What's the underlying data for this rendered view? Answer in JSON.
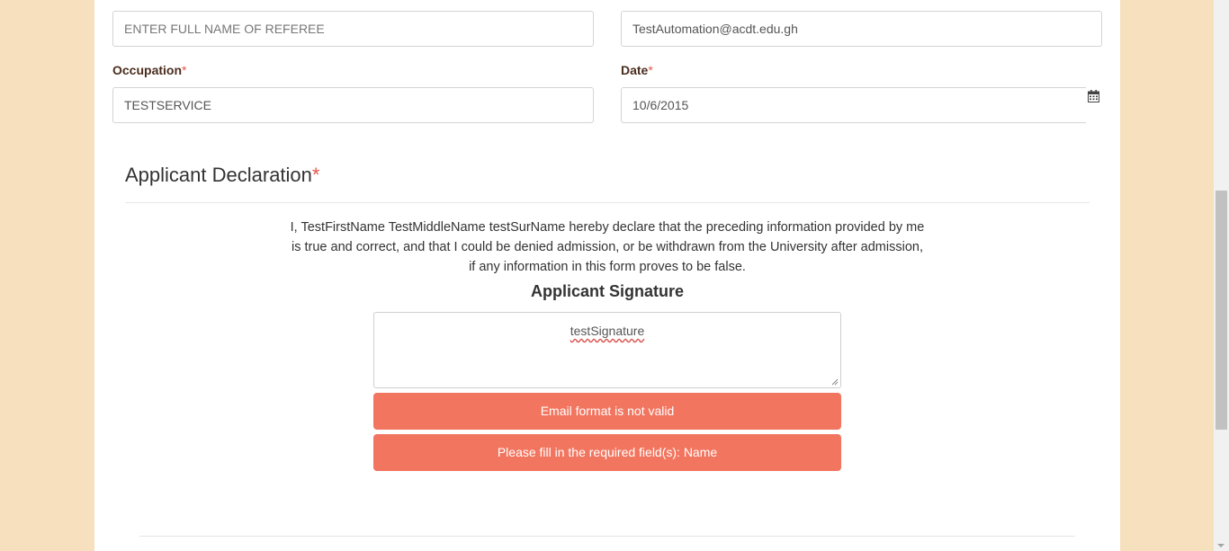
{
  "form": {
    "referee_name": {
      "placeholder": "ENTER FULL NAME OF REFEREE",
      "value": ""
    },
    "referee_email": {
      "value": "TestAutomation@acdt.edu.gh"
    },
    "occupation": {
      "label": "Occupation",
      "required_mark": "*",
      "value": "TESTSERVICE"
    },
    "date": {
      "label": "Date",
      "required_mark": "*",
      "value": "10/6/2015",
      "icon": "calendar-icon"
    }
  },
  "declaration": {
    "title": "Applicant Declaration",
    "required_mark": "*",
    "text": "I, TestFirstName TestMiddleName testSurName hereby declare that the preceding information provided by me is true and correct, and that I could be denied admission, or be withdrawn from the University after admission, if any information in this form proves to be false.",
    "signature_heading": "Applicant Signature",
    "signature_value": "testSignature"
  },
  "alerts": [
    {
      "text": "Email format is not valid"
    },
    {
      "text": "Please fill in the required field(s): Name"
    }
  ],
  "colors": {
    "background": "#f7e0bd",
    "alert": "#f2755f",
    "required": "#e2574c",
    "label": "#4b2d1e"
  }
}
